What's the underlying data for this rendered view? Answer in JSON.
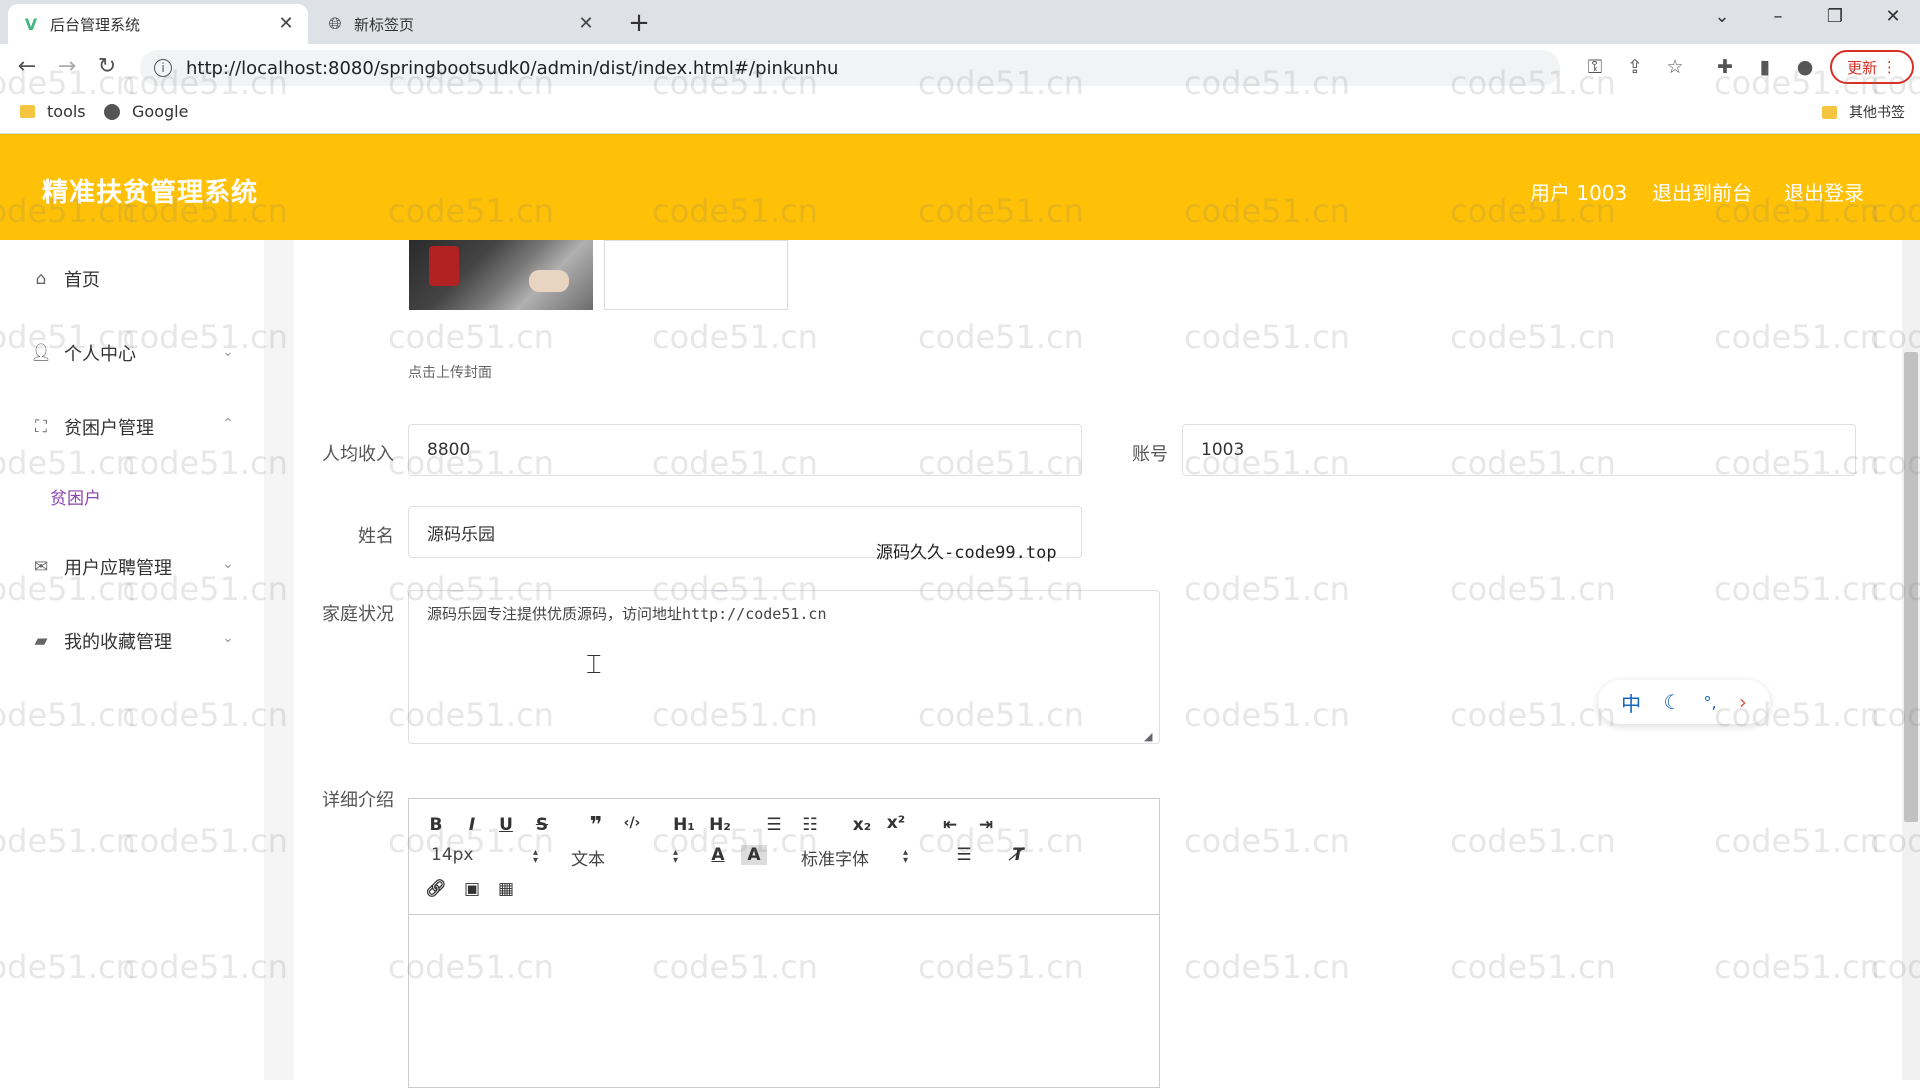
{
  "browser": {
    "tabs": [
      {
        "title": "后台管理系统",
        "active": true
      },
      {
        "title": "新标签页",
        "active": false
      }
    ],
    "url": "http://localhost:8080/springbootsudk0/admin/dist/index.html#/pinkunhu",
    "update_label": "更新",
    "bookmarks": [
      "tools",
      "Google"
    ],
    "other_bookmarks": "其他书签"
  },
  "header": {
    "title": "精准扶贫管理系统",
    "user": "用户 1003",
    "exit_front": "退出到前台",
    "logout": "退出登录",
    "color": "#ffc107"
  },
  "sidebar": {
    "items": [
      {
        "label": "首页",
        "icon": "home-icon"
      },
      {
        "label": "个人中心",
        "icon": "user-icon"
      },
      {
        "label": "贫困户管理",
        "icon": "frame-icon"
      },
      {
        "label": "用户应聘管理",
        "icon": "mail-icon"
      },
      {
        "label": "我的收藏管理",
        "icon": "bag-icon"
      }
    ],
    "sub_item": "贫困户"
  },
  "form": {
    "upload_hint": "点击上传封面",
    "income_label": "人均收入",
    "income_value": "8800",
    "account_label": "账号",
    "account_value": "1003",
    "name_label": "姓名",
    "name_value": "源码乐园",
    "family_label": "家庭状况",
    "family_value": "源码乐园专注提供优质源码，访问地址http://code51.cn",
    "detail_label": "详细介绍"
  },
  "editor": {
    "font_size": "14px",
    "format": "文本",
    "font": "标准字体"
  },
  "overlay_text": "源码久久-code99.top",
  "floating_toolbar": {
    "ime": "中"
  },
  "watermark": "code51.cn"
}
